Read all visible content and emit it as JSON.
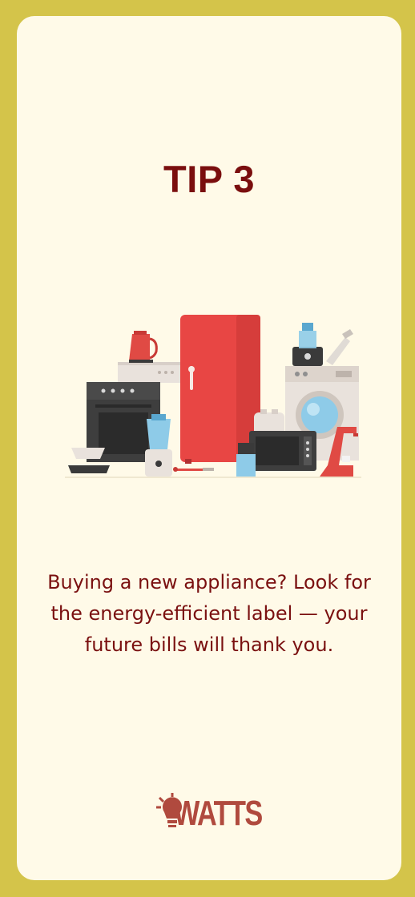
{
  "tip": {
    "title": "TIP 3",
    "text": "Buying a new appliance? Look for the energy-efficient label — your future bills will thank you."
  },
  "illustration": {
    "subject": "household-appliances"
  },
  "brand": {
    "name": "WATTS",
    "color": "#b04a3e",
    "icon": "lightbulb-icon"
  },
  "colors": {
    "frame": "#d4c44a",
    "card": "#fffae8",
    "title": "#7a0e0e",
    "text": "#7a1010"
  }
}
